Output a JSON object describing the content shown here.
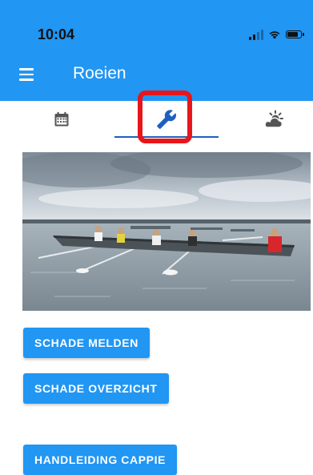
{
  "status_bar": {
    "time": "10:04"
  },
  "header": {
    "title": "Roeien",
    "menu_icon": "hamburger-menu-icon"
  },
  "tabs": [
    {
      "icon": "calendar-icon",
      "selected": false
    },
    {
      "icon": "wrench-icon",
      "selected": true
    },
    {
      "icon": "weather-sun-cloud-icon",
      "selected": false
    }
  ],
  "colors": {
    "primary": "#2196f3",
    "tab_indicator": "#1f5fbf",
    "highlight": "#e8161a"
  },
  "actions": {
    "report_damage": "SCHADE MELDEN",
    "damage_overview": "SCHADE OVERZICHT",
    "manual": "HANDLEIDING CAPPIE"
  }
}
